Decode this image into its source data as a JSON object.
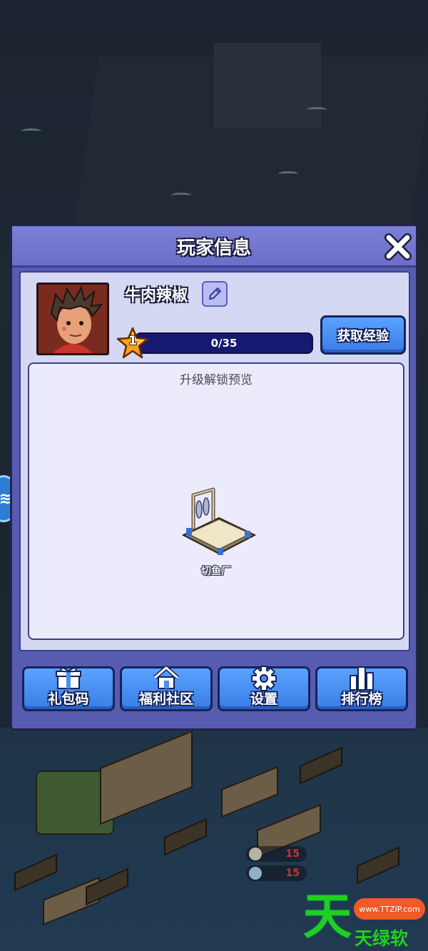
{
  "dialog": {
    "title": "玩家信息",
    "close_icon": "close-x-icon"
  },
  "player": {
    "name": "牛肉辣椒",
    "level": "1",
    "xp_text": "0/35",
    "xp_fraction": 0.0,
    "avatar_icon": "player-portrait"
  },
  "buttons": {
    "get_xp": "获取经验",
    "gift_code": "礼包码",
    "welfare": "福利社区",
    "settings": "设置",
    "ranking": "排行榜"
  },
  "preview": {
    "title": "升级解锁预览",
    "items": [
      {
        "label": "切鱼厂",
        "icon": "fish-cutting-workshop-icon"
      }
    ]
  },
  "scene": {
    "resources": [
      {
        "value": "15",
        "icon": "stone-icon"
      },
      {
        "value": "15",
        "icon": "gear-resource-icon"
      }
    ]
  },
  "watermark": {
    "big": "天",
    "text": "天绿软",
    "pill": "www.TTZIP.com"
  },
  "colors": {
    "dialog_bg": "#585cb0",
    "header_bg": "#7c80d6",
    "panel_bg": "#d4d8f3",
    "button_blue": "#4a8ef2",
    "xp_bar": "#151a70"
  }
}
